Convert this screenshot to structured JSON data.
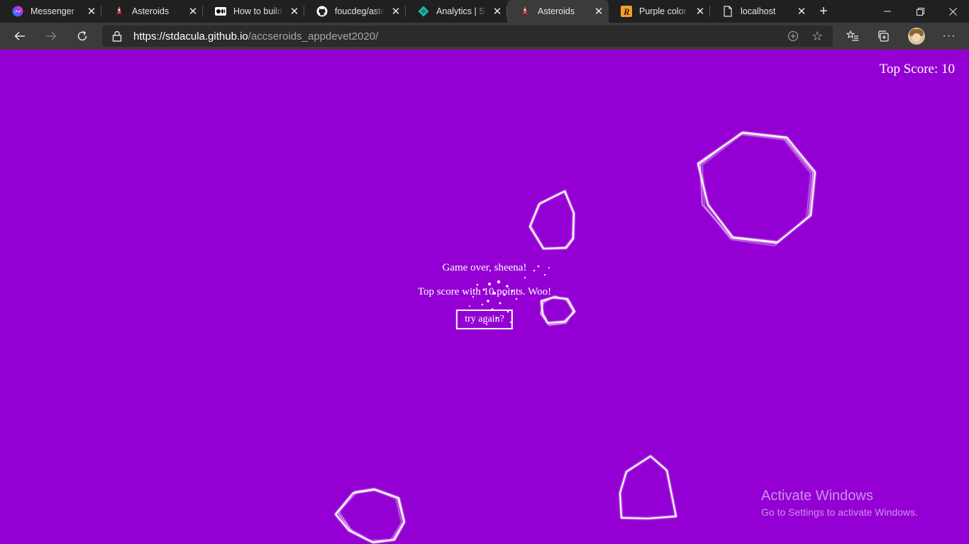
{
  "browser": {
    "tabs": [
      {
        "label": "Messenger",
        "icon": "messenger-icon"
      },
      {
        "label": "Asteroids",
        "icon": "rocket-icon"
      },
      {
        "label": "How to build a",
        "icon": "medium-icon"
      },
      {
        "label": "foucdeg/asteroids",
        "icon": "github-icon"
      },
      {
        "label": "Analytics | Site",
        "icon": "analytics-icon"
      },
      {
        "label": "Asteroids",
        "icon": "rocket-icon",
        "active": true
      },
      {
        "label": "Purple color c",
        "icon": "r-logo-icon"
      },
      {
        "label": "localhost",
        "icon": "document-icon"
      }
    ],
    "url": {
      "host": "https://stdacula.github.io",
      "path": "/accseroids_appdevet2020/"
    }
  },
  "game": {
    "top_score_label": "Top Score: 10",
    "game_over_text": "Game over, sheena!",
    "score_text": "Top score with 10 points. Woo!",
    "try_again_label": "try again?",
    "background_color": "#9400d3"
  },
  "os_watermark": {
    "title": "Activate Windows",
    "subtitle": "Go to Settings to activate Windows."
  }
}
